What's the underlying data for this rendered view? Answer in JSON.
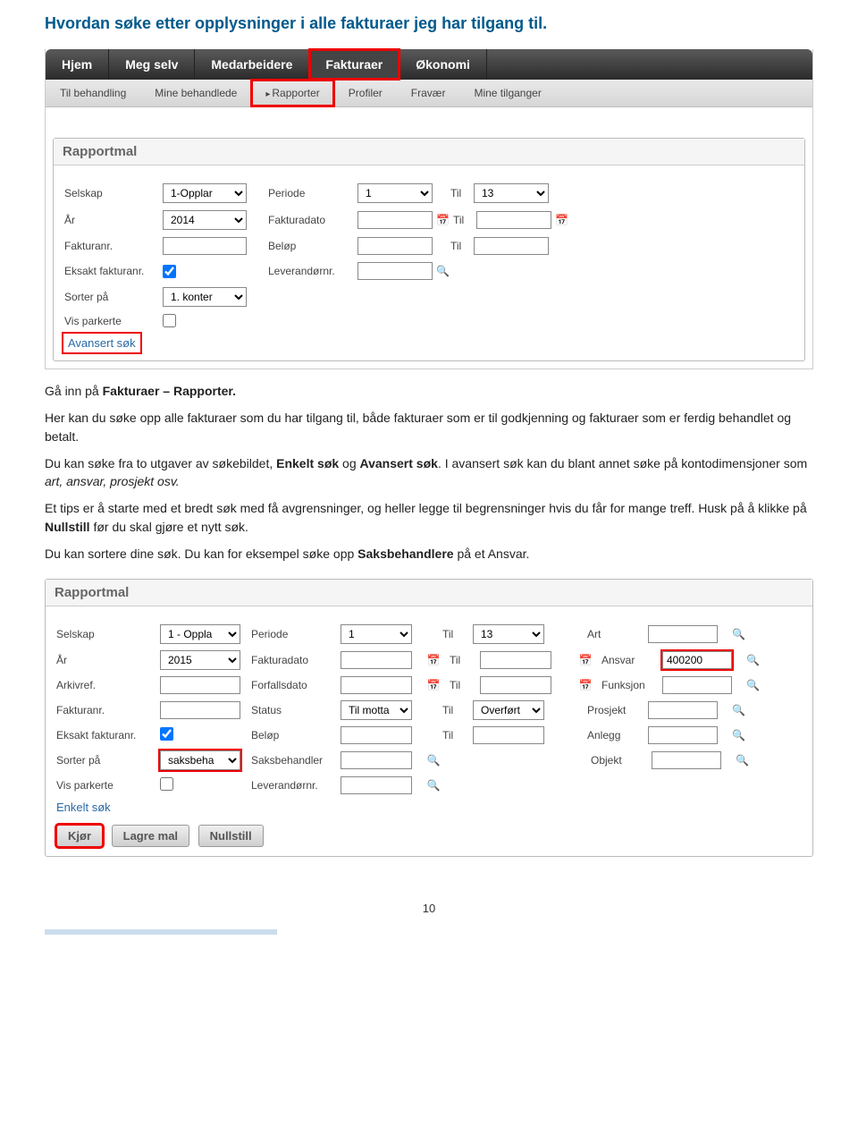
{
  "title": "Hvordan søke etter opplysninger i alle fakturaer jeg har tilgang til.",
  "nav_main": [
    "Hjem",
    "Meg selv",
    "Medarbeidere",
    "Fakturaer",
    "Økonomi"
  ],
  "nav_main_active": 3,
  "nav_sub": [
    "Til behandling",
    "Mine behandlede",
    "Rapporter",
    "Profiler",
    "Fravær",
    "Mine tilganger"
  ],
  "nav_sub_active": 2,
  "panel1": {
    "header": "Rapportmal",
    "labels": {
      "selskap": "Selskap",
      "ar": "År",
      "fakturanr": "Fakturanr.",
      "eksakt": "Eksakt fakturanr.",
      "sorter": "Sorter på",
      "parkerte": "Vis parkerte",
      "periode": "Periode",
      "fakturadato": "Fakturadato",
      "belop": "Beløp",
      "levnr": "Leverandørnr.",
      "til": "Til"
    },
    "values": {
      "selskap": "1-Opplar",
      "ar": "2014",
      "sorter": "1. konter",
      "periode_from": "1",
      "periode_to": "13"
    },
    "advlink": "Avansert søk"
  },
  "body": {
    "p1a": "Gå inn på ",
    "p1b": "Fakturaer – Rapporter.",
    "p2": "Her kan du søke opp alle fakturaer som du har tilgang til, både fakturaer som er til godkjenning og fakturaer som er ferdig behandlet og betalt.",
    "p3a": "Du kan søke fra to utgaver av søkebildet, ",
    "p3b": "Enkelt søk",
    "p3c": " og ",
    "p3d": "Avansert søk",
    "p3e": ". I avansert søk kan du blant annet søke på kontodimensjoner som ",
    "p3f": "art, ansvar, prosjekt osv.",
    "p4a": "Et tips er å starte med et bredt søk med få avgrensninger, og heller legge til begrensninger hvis du får for mange treff. Husk på å klikke på ",
    "p4b": "Nullstill",
    "p4c": " før du skal gjøre et nytt søk.",
    "p5a": "Du kan sortere dine søk. Du kan for eksempel søke opp ",
    "p5b": "Saksbehandlere",
    "p5c": " på et Ansvar."
  },
  "panel2": {
    "header": "Rapportmal",
    "labels": {
      "selskap": "Selskap",
      "ar": "År",
      "arkivref": "Arkivref.",
      "fakturanr": "Fakturanr.",
      "eksakt": "Eksakt fakturanr.",
      "sorter": "Sorter på",
      "parkerte": "Vis parkerte",
      "periode": "Periode",
      "fakturadato": "Fakturadato",
      "forfall": "Forfallsdato",
      "status": "Status",
      "belop": "Beløp",
      "saksbeh": "Saksbehandler",
      "levnr": "Leverandørnr.",
      "til": "Til",
      "art": "Art",
      "ansvar": "Ansvar",
      "funksjon": "Funksjon",
      "prosjekt": "Prosjekt",
      "anlegg": "Anlegg",
      "objekt": "Objekt"
    },
    "values": {
      "selskap": "1 - Oppla",
      "ar": "2015",
      "sorter": "saksbeha",
      "periode_from": "1",
      "periode_to": "13",
      "status_from": "Til motta",
      "status_to": "Overført",
      "ansvar": "400200"
    },
    "link": "Enkelt søk",
    "buttons": {
      "kjor": "Kjør",
      "lagre": "Lagre mal",
      "nullstill": "Nullstill"
    }
  },
  "page_number": "10"
}
